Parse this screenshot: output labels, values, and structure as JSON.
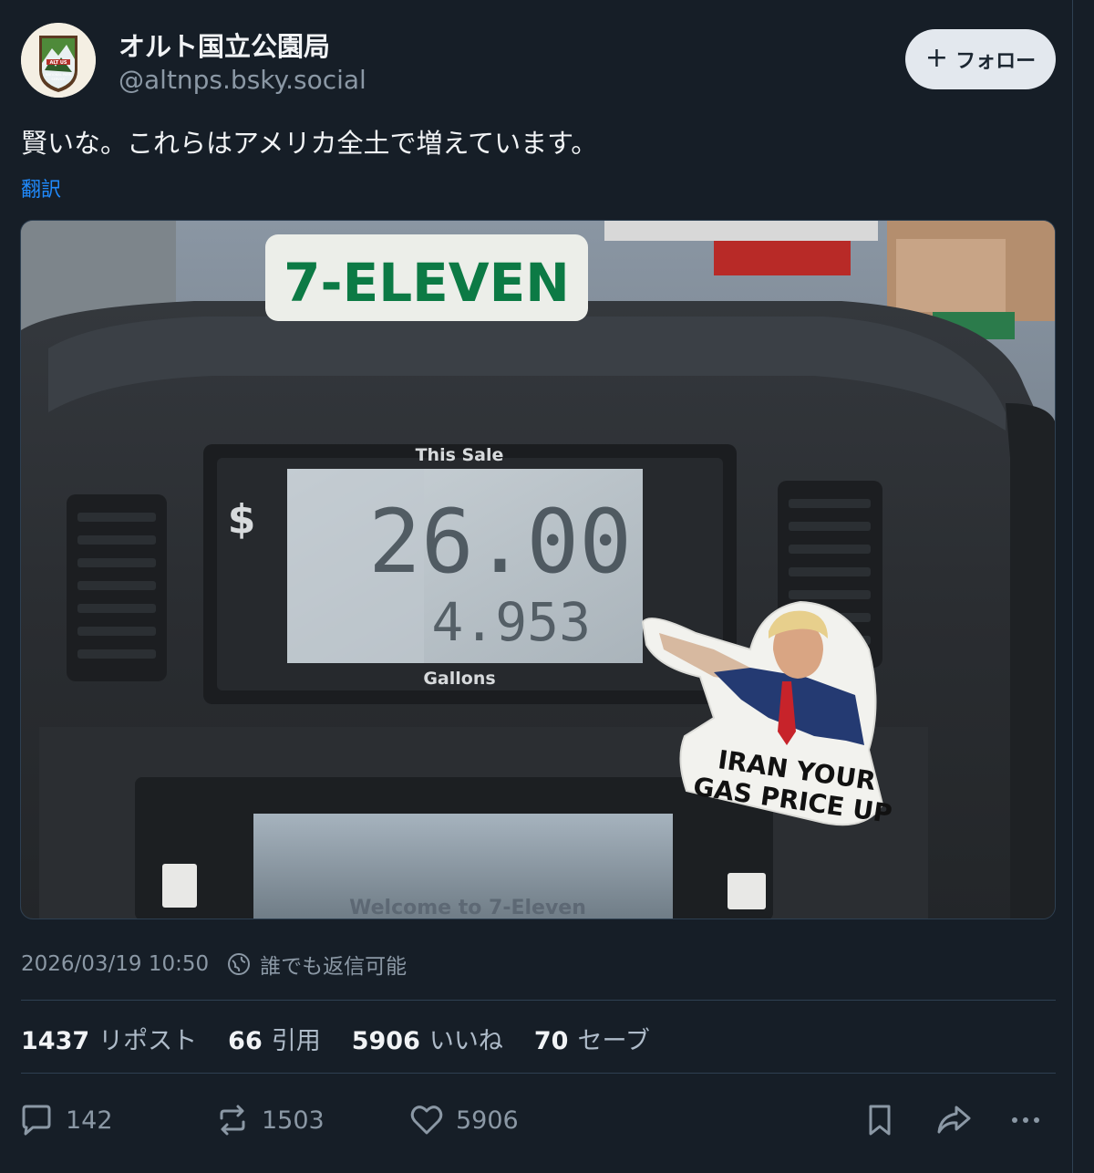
{
  "author": {
    "display_name": "オルト国立公園局",
    "handle": "@altnps.bsky.social",
    "avatar_icon": "altnps-logo-icon"
  },
  "follow_button": {
    "label": "フォロー",
    "icon": "plus-icon"
  },
  "post": {
    "text": "賢いな。これらはアメリカ全土で増えています。",
    "translate_label": "翻訳"
  },
  "image": {
    "pump_brand": "7-ELEVEN",
    "display_top_label": "This Sale",
    "display_bottom_label": "Gallons",
    "dollar_sign": "$",
    "sale_amount": "26.00",
    "gallons": "4.953",
    "sticker_line1": "IRAN YOUR",
    "sticker_line2": "GAS PRICE UP",
    "lower_screen_text": "Welcome to 7-Eleven"
  },
  "meta": {
    "timestamp": "2026/03/19 10:50",
    "reply_setting": "誰でも返信可能",
    "reply_setting_icon": "globe-icon"
  },
  "stats": [
    {
      "count": "1437",
      "label": "リポスト"
    },
    {
      "count": "66",
      "label": "引用"
    },
    {
      "count": "5906",
      "label": "いいね"
    },
    {
      "count": "70",
      "label": "セーブ"
    }
  ],
  "actions": {
    "reply_count": "142",
    "repost_count": "1503",
    "like_count": "5906"
  },
  "colors": {
    "background": "#161e27",
    "text": "#f1f3f5",
    "muted": "#8b98a5",
    "link": "#208bfe",
    "divider": "#2e4052",
    "follow_bg": "#e3e8ee"
  }
}
